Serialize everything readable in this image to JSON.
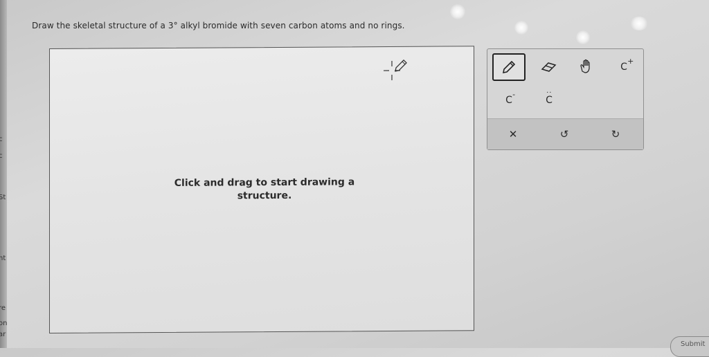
{
  "question": {
    "text": "Draw the skeletal structure of a 3° alkyl bromide with seven carbon atoms and no rings."
  },
  "canvas": {
    "hint_line1": "Click and drag to start drawing a",
    "hint_line2": "structure."
  },
  "toolbar": {
    "tools": [
      {
        "name": "pencil-tool",
        "icon": "pencil-icon",
        "active": true
      },
      {
        "name": "eraser-tool",
        "icon": "eraser-icon"
      },
      {
        "name": "hand-tool",
        "icon": "hand-icon"
      },
      {
        "name": "carbocation-tool",
        "label": "C",
        "charge": "+"
      },
      {
        "name": "carbanion-tool",
        "label": "C",
        "charge": "-"
      },
      {
        "name": "carbene-tool",
        "label": "C",
        "dots": "··"
      }
    ],
    "actions": {
      "clear": "✕",
      "undo": "↺",
      "redo": "↻"
    }
  },
  "submit": {
    "label": "Submit"
  },
  "left_edge": {
    "fragments": [
      "c",
      "c",
      "St",
      "nt",
      "re",
      "on",
      "ar"
    ]
  }
}
